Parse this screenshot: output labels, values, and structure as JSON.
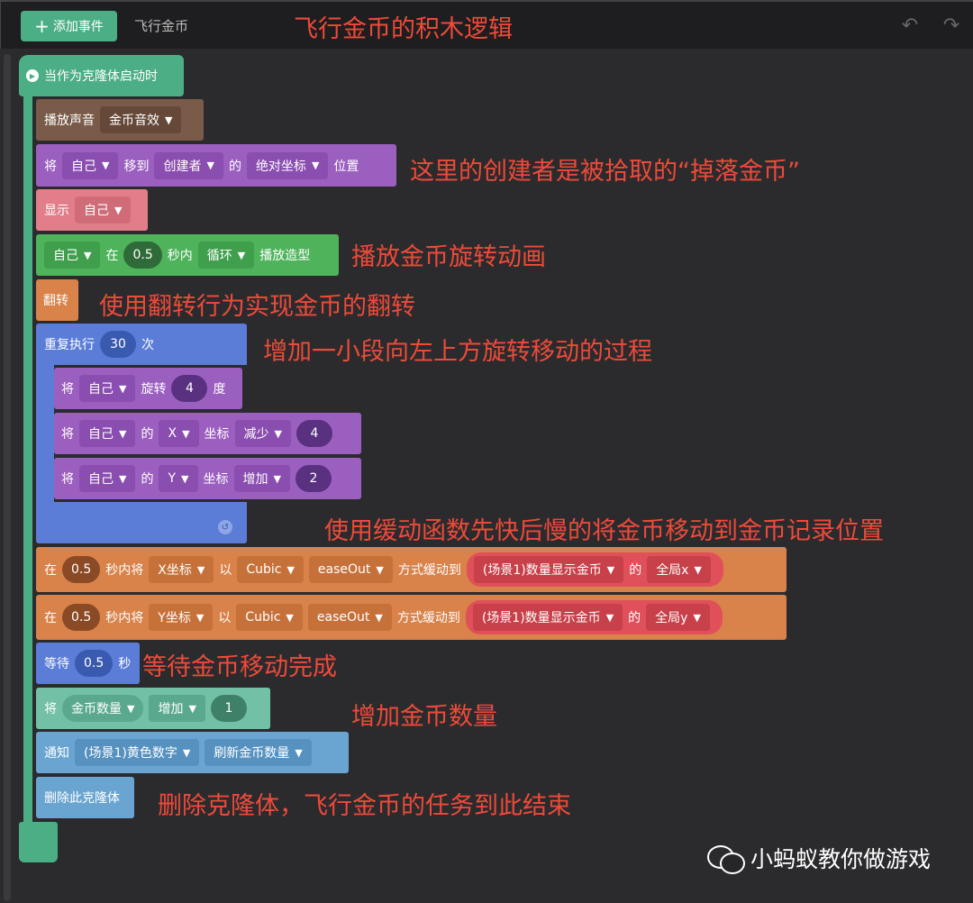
{
  "toolbar": {
    "add_event_label": "添加事件",
    "tab_name": "飞行金币",
    "undo_icon": "↶",
    "redo_icon": "↷"
  },
  "hat": {
    "label": "当作为克隆体启动时"
  },
  "blocks": {
    "play_sound": {
      "label": "播放声音",
      "sound": "金币音效"
    },
    "move_to": {
      "w1": "将",
      "target": "自己",
      "w2": "移到",
      "creator": "创建者",
      "w3": "的",
      "coord": "绝对坐标",
      "w4": "位置"
    },
    "show": {
      "label": "显示",
      "target": "自己"
    },
    "play_anim": {
      "target": "自己",
      "w1": "在",
      "seconds": "0.5",
      "w2": "秒内",
      "mode": "循环",
      "w3": "播放造型"
    },
    "flip": {
      "label": "翻转"
    },
    "repeat": {
      "label": "重复执行",
      "count": "30",
      "unit": "次"
    },
    "rotate": {
      "w1": "将",
      "target": "自己",
      "w2": "旋转",
      "deg": "4",
      "unit": "度"
    },
    "x_change": {
      "w1": "将",
      "target": "自己",
      "w2": "的",
      "axis": "X",
      "w3": "坐标",
      "op": "减少",
      "value": "4"
    },
    "y_change": {
      "w1": "将",
      "target": "自己",
      "w2": "的",
      "axis": "Y",
      "w3": "坐标",
      "op": "增加",
      "value": "2"
    },
    "ease_x": {
      "w1": "在",
      "seconds": "0.5",
      "w2": "秒内将",
      "prop": "X坐标",
      "w3": "以",
      "func": "Cubic",
      "ease": "easeOut",
      "w4": "方式缓动到",
      "obj": "(场景1)数量显示金币",
      "w5": "的",
      "global": "全局x"
    },
    "ease_y": {
      "w1": "在",
      "seconds": "0.5",
      "w2": "秒内将",
      "prop": "Y坐标",
      "w3": "以",
      "func": "Cubic",
      "ease": "easeOut",
      "w4": "方式缓动到",
      "obj": "(场景1)数量显示金币",
      "w5": "的",
      "global": "全局y"
    },
    "wait": {
      "w1": "等待",
      "seconds": "0.5",
      "w2": "秒"
    },
    "coin_add": {
      "w1": "将",
      "var": "金币数量",
      "op": "增加",
      "value": "1"
    },
    "notify": {
      "w1": "通知",
      "target": "(场景1)黄色数字",
      "msg": "刷新金币数量"
    },
    "delete": {
      "label": "删除此克隆体"
    }
  },
  "annotations": {
    "title": "飞行金币的积木逻辑",
    "a1": "这里的创建者是被拾取的“掉落金币”",
    "a2": "播放金币旋转动画",
    "a3": "使用翻转行为实现金币的翻转",
    "a4": "增加一小段向左上方旋转移动的过程",
    "a5": "使用缓动函数先快后慢的将金币移动到金币记录位置",
    "a6": "等待金币移动完成",
    "a7": "增加金币数量",
    "a8": "删除克隆体，飞行金币的任务到此结束"
  },
  "watermark": {
    "text": "小蚂蚁教你做游戏"
  }
}
